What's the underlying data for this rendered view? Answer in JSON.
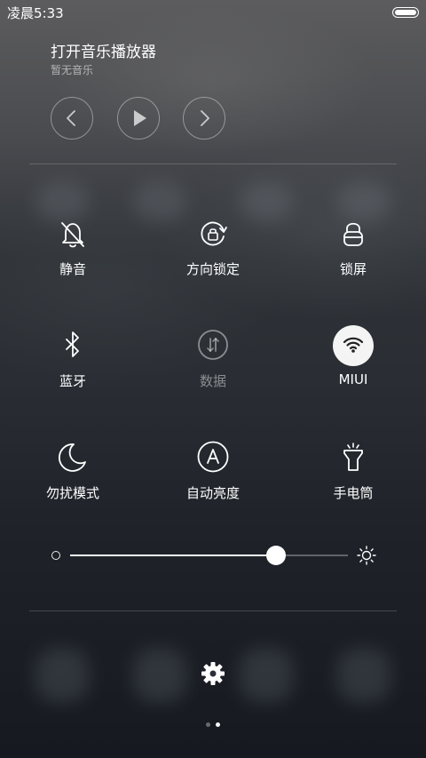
{
  "status_bar": {
    "time": "凌晨5:33",
    "battery_level": 1.0
  },
  "music": {
    "title": "打开音乐播放器",
    "subtitle": "暂无音乐",
    "controls": [
      "chevron-left-icon",
      "play-icon",
      "chevron-right-icon"
    ]
  },
  "toggles": [
    {
      "label": "静音",
      "icon": "bell-off-icon",
      "state": "off"
    },
    {
      "label": "方向锁定",
      "icon": "rotation-lock-icon",
      "state": "off"
    },
    {
      "label": "锁屏",
      "icon": "lock-icon",
      "state": "off"
    },
    {
      "label": "蓝牙",
      "icon": "bluetooth-icon",
      "state": "off"
    },
    {
      "label": "数据",
      "icon": "mobile-data-icon",
      "state": "disabled"
    },
    {
      "label": "MIUI",
      "icon": "wifi-icon",
      "state": "on"
    },
    {
      "label": "勿扰模式",
      "icon": "moon-icon",
      "state": "off"
    },
    {
      "label": "自动亮度",
      "icon": "auto-brightness-icon",
      "state": "off"
    },
    {
      "label": "手电筒",
      "icon": "flashlight-icon",
      "state": "off"
    }
  ],
  "brightness": {
    "level": 0.74,
    "low_icon": "brightness-low-icon",
    "high_icon": "brightness-high-icon"
  },
  "footer": {
    "settings_icon": "gear-icon",
    "pages": 2,
    "active_page": 2
  },
  "colors": {
    "active_toggle_bg": "#f4f4f4",
    "active_icon": "#222222",
    "icon": "#ffffff",
    "disabled": "rgba(255,255,255,0.45)"
  }
}
